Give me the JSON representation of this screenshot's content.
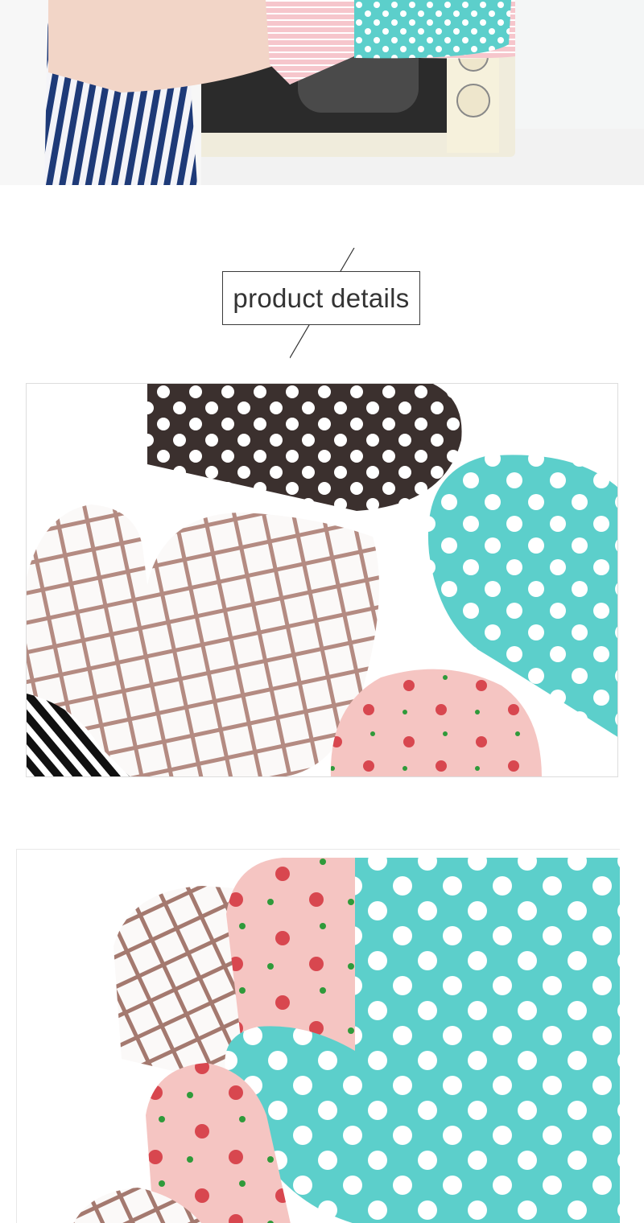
{
  "section_title": {
    "text": "product details"
  },
  "photos": [
    {
      "subject": "hand-in-oven-mitt-microwave"
    },
    {
      "subject": "four-oven-mitts-flat-lay"
    },
    {
      "subject": "stacked-oven-mitts"
    }
  ],
  "colors": {
    "brown_dot": "#3b302e",
    "teal": "#5ccfcb",
    "pink": "#f5c5c2",
    "check_line": "#b48b82",
    "flower_red": "#d8474f"
  }
}
